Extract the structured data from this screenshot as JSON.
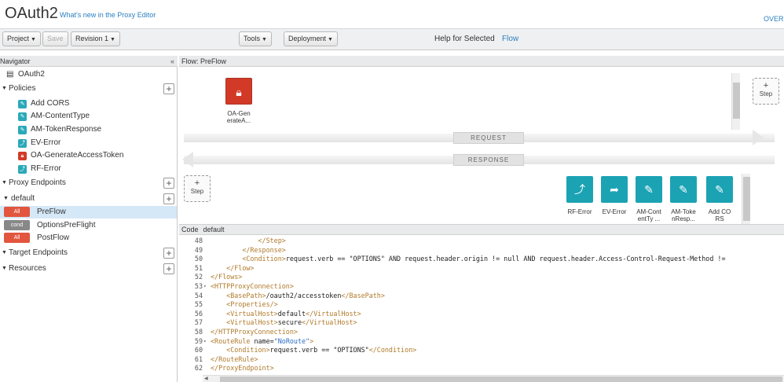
{
  "header": {
    "title": "OAuth2",
    "whats_new": "What's new in the Proxy Editor",
    "overview": "OVER"
  },
  "toolbar": {
    "project": "Project",
    "save": "Save",
    "revision": "Revision 1",
    "tools": "Tools",
    "deployment": "Deployment",
    "help_label": "Help for Selected",
    "help_link": "Flow"
  },
  "navigator": {
    "title": "Navigator",
    "collapse": "«",
    "proxy_name": "OAuth2",
    "policies_label": "Policies",
    "policies": [
      {
        "icon": "assign-message-icon",
        "label": "Add CORS"
      },
      {
        "icon": "assign-message-icon",
        "label": "AM-ContentType"
      },
      {
        "icon": "assign-message-icon",
        "label": "AM-TokenResponse"
      },
      {
        "icon": "raise-fault-icon",
        "label": "EV-Error"
      },
      {
        "icon": "lock-icon",
        "label": "OA-GenerateAccessToken"
      },
      {
        "icon": "raise-fault-icon",
        "label": "RF-Error"
      }
    ],
    "proxy_endpoints_label": "Proxy Endpoints",
    "default_label": "default",
    "flows": [
      {
        "tag": "All",
        "label": "PreFlow"
      },
      {
        "tag": "cond",
        "label": "OptionsPreFlight"
      },
      {
        "tag": "All",
        "label": "PostFlow"
      }
    ],
    "target_endpoints_label": "Target Endpoints",
    "resources_label": "Resources",
    "plus": "+"
  },
  "flow": {
    "header": "Flow: PreFlow",
    "request": "REQUEST",
    "response": "RESPONSE",
    "step_plus": "+",
    "step_label": "Step",
    "request_policy": {
      "icon": "lock-icon",
      "caption_1": "OA-Gen",
      "caption_2": "erateA..."
    },
    "response_policies": [
      {
        "icon": "raise-fault-icon",
        "caption_1": "RF-Error",
        "caption_2": ""
      },
      {
        "icon": "extract-variables-icon",
        "caption_1": "EV-Error",
        "caption_2": ""
      },
      {
        "icon": "pencil-icon",
        "caption_1": "AM-Cont",
        "caption_2": "entTy ..."
      },
      {
        "icon": "pencil-icon",
        "caption_1": "AM-Toke",
        "caption_2": "nResp..."
      },
      {
        "icon": "pencil-icon",
        "caption_1": "Add CO",
        "caption_2": "RS"
      }
    ]
  },
  "code": {
    "label": "Code",
    "file": "default",
    "lines": [
      {
        "n": "48",
        "fold": "",
        "text": "            </Step>"
      },
      {
        "n": "49",
        "fold": "",
        "text": "        </Response>"
      },
      {
        "n": "50",
        "fold": "",
        "text": "        <Condition>request.verb == \"OPTIONS\" AND request.header.origin != null AND request.header.Access-Control-Request-Method !="
      },
      {
        "n": "51",
        "fold": "",
        "text": "    </Flow>"
      },
      {
        "n": "52",
        "fold": "",
        "text": "</Flows>"
      },
      {
        "n": "53",
        "fold": "▾",
        "text": "<HTTPProxyConnection>"
      },
      {
        "n": "54",
        "fold": "",
        "text": "    <BasePath>/oauth2/accesstoken</BasePath>"
      },
      {
        "n": "55",
        "fold": "",
        "text": "    <Properties/>"
      },
      {
        "n": "56",
        "fold": "",
        "text": "    <VirtualHost>default</VirtualHost>"
      },
      {
        "n": "57",
        "fold": "",
        "text": "    <VirtualHost>secure</VirtualHost>"
      },
      {
        "n": "58",
        "fold": "",
        "text": "</HTTPProxyConnection>"
      },
      {
        "n": "59",
        "fold": "▾",
        "text": "<RouteRule name=\"NoRoute\">"
      },
      {
        "n": "60",
        "fold": "",
        "text": "    <Condition>request.verb == \"OPTIONS\"</Condition>"
      },
      {
        "n": "61",
        "fold": "",
        "text": "</RouteRule>"
      },
      {
        "n": "62",
        "fold": "",
        "text": "</ProxyEndpoint>"
      }
    ]
  }
}
